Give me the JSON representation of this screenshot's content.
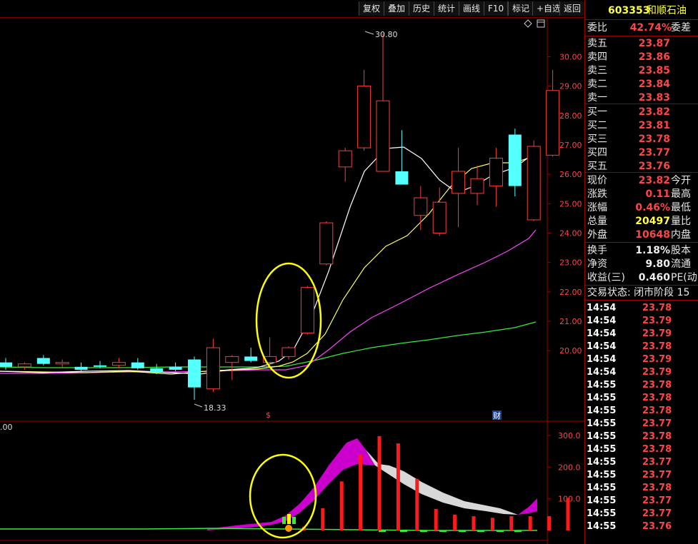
{
  "toolbar": {
    "buttons": [
      "复权",
      "叠加",
      "历史",
      "统计",
      "画线",
      "F10",
      "标记",
      "+自选",
      "返回"
    ]
  },
  "stock": {
    "code": "603353",
    "name": "和顺石油"
  },
  "main_chart": {
    "price_ticks": [
      "30.00",
      "29.00",
      "28.00",
      "27.00",
      "26.00",
      "25.00",
      "24.00",
      "23.00",
      "22.00",
      "21.00",
      "20.00"
    ],
    "high_label": "30.80",
    "low_label": "18.33",
    "markers": {
      "s_mark": "$",
      "cai_mark": "财"
    },
    "colors": {
      "up": "#ff3b3b",
      "down": "#54ffff",
      "ma5": "#ffffff",
      "ma10": "#ffff66",
      "ma20": "#ff44ff",
      "ma60": "#33ee33",
      "highlight": "#ffff00"
    }
  },
  "sub_chart": {
    "left_label": ".00",
    "ticks": [
      "300.0",
      "200.0",
      "100.0"
    ]
  },
  "chart_data": [
    {
      "type": "candlestick",
      "y_range": [
        17.6,
        31.2
      ],
      "candles": [
        {
          "o": 19.6,
          "h": 19.75,
          "l": 19.35,
          "c": 19.45
        },
        {
          "o": 19.45,
          "h": 19.6,
          "l": 19.35,
          "c": 19.55
        },
        {
          "o": 19.75,
          "h": 19.85,
          "l": 19.5,
          "c": 19.55
        },
        {
          "o": 19.55,
          "h": 19.7,
          "l": 19.4,
          "c": 19.6
        },
        {
          "o": 19.45,
          "h": 19.6,
          "l": 19.3,
          "c": 19.35
        },
        {
          "o": 19.5,
          "h": 19.65,
          "l": 19.4,
          "c": 19.45
        },
        {
          "o": 19.5,
          "h": 19.75,
          "l": 19.4,
          "c": 19.6
        },
        {
          "o": 19.6,
          "h": 19.75,
          "l": 19.35,
          "c": 19.4
        },
        {
          "o": 19.4,
          "h": 19.55,
          "l": 19.2,
          "c": 19.25
        },
        {
          "o": 19.45,
          "h": 19.6,
          "l": 19.3,
          "c": 19.35
        },
        {
          "o": 19.7,
          "h": 19.8,
          "l": 18.33,
          "c": 18.75
        },
        {
          "o": 18.7,
          "h": 20.4,
          "l": 18.6,
          "c": 20.1
        },
        {
          "o": 19.6,
          "h": 19.85,
          "l": 19.0,
          "c": 19.8
        },
        {
          "o": 19.8,
          "h": 20.1,
          "l": 19.6,
          "c": 19.65
        },
        {
          "o": 19.6,
          "h": 20.45,
          "l": 19.5,
          "c": 19.8
        },
        {
          "o": 19.8,
          "h": 20.15,
          "l": 19.7,
          "c": 20.1
        },
        {
          "o": 20.6,
          "h": 22.2,
          "l": 20.55,
          "c": 22.15
        },
        {
          "o": 22.95,
          "h": 24.4,
          "l": 22.9,
          "c": 24.35
        },
        {
          "o": 26.25,
          "h": 26.9,
          "l": 25.75,
          "c": 26.8
        },
        {
          "o": 26.9,
          "h": 29.55,
          "l": 26.8,
          "c": 29.0
        },
        {
          "o": 26.1,
          "h": 30.8,
          "l": 26.1,
          "c": 28.5
        },
        {
          "o": 26.1,
          "h": 27.5,
          "l": 25.7,
          "c": 25.65
        },
        {
          "o": 24.6,
          "h": 25.6,
          "l": 24.1,
          "c": 25.2
        },
        {
          "o": 24.0,
          "h": 25.55,
          "l": 23.9,
          "c": 25.05
        },
        {
          "o": 25.35,
          "h": 26.9,
          "l": 24.2,
          "c": 26.1
        },
        {
          "o": 25.35,
          "h": 26.3,
          "l": 24.95,
          "c": 25.85
        },
        {
          "o": 25.6,
          "h": 26.9,
          "l": 24.9,
          "c": 26.55
        },
        {
          "o": 27.35,
          "h": 27.55,
          "l": 25.25,
          "c": 25.6
        },
        {
          "o": 24.45,
          "h": 27.15,
          "l": 24.4,
          "c": 26.95
        },
        {
          "o": 26.65,
          "h": 29.55,
          "l": 26.6,
          "c": 28.85
        }
      ]
    },
    {
      "type": "bar",
      "y_range": [
        0,
        300
      ],
      "values": [
        0,
        0,
        0,
        0,
        0,
        0,
        0,
        0,
        0,
        0,
        0,
        0,
        0,
        0,
        0,
        0,
        12,
        70,
        155,
        240,
        298,
        275,
        163,
        68,
        50,
        45,
        40,
        45,
        45,
        45,
        102
      ]
    }
  ],
  "side_panel": {
    "weibi": {
      "label": "委比",
      "value": "42.74%",
      "label2": "委差"
    },
    "sells": [
      {
        "label": "卖五",
        "price": "23.87"
      },
      {
        "label": "卖四",
        "price": "23.86"
      },
      {
        "label": "卖三",
        "price": "23.85"
      },
      {
        "label": "卖二",
        "price": "23.84"
      },
      {
        "label": "卖一",
        "price": "23.83"
      }
    ],
    "buys": [
      {
        "label": "买一",
        "price": "23.82"
      },
      {
        "label": "买二",
        "price": "23.81"
      },
      {
        "label": "买三",
        "price": "23.78"
      },
      {
        "label": "买四",
        "price": "23.77"
      },
      {
        "label": "买五",
        "price": "23.76"
      }
    ],
    "stats1": [
      {
        "label": "现价",
        "value": "23.82",
        "label2": "今开"
      },
      {
        "label": "涨跌",
        "value": "0.11",
        "label2": "最高"
      },
      {
        "label": "涨幅",
        "value": "0.46%",
        "label2": "最低"
      },
      {
        "label": "总量",
        "value": "20497",
        "label2": "量比"
      },
      {
        "label": "外盘",
        "value": "10648",
        "label2": "内盘"
      }
    ],
    "stats2": [
      {
        "label": "换手",
        "value": "1.18%",
        "label2": "股本"
      },
      {
        "label": "净资",
        "value": "9.80",
        "label2": "流通"
      },
      {
        "label": "收益(三)",
        "value": "0.460",
        "label2": "PE(动"
      }
    ],
    "trade_status": "交易状态: 闭市阶段 15",
    "ticks": [
      {
        "time": "14:54",
        "price": "23.78"
      },
      {
        "time": "14:54",
        "price": "23.79"
      },
      {
        "time": "14:54",
        "price": "23.79"
      },
      {
        "time": "14:54",
        "price": "23.78"
      },
      {
        "time": "14:54",
        "price": "23.79"
      },
      {
        "time": "14:54",
        "price": "23.79"
      },
      {
        "time": "14:55",
        "price": "23.78"
      },
      {
        "time": "14:55",
        "price": "23.78"
      },
      {
        "time": "14:55",
        "price": "23.78"
      },
      {
        "time": "14:55",
        "price": "23.77"
      },
      {
        "time": "14:55",
        "price": "23.78"
      },
      {
        "time": "14:55",
        "price": "23.78"
      },
      {
        "time": "14:55",
        "price": "23.77"
      },
      {
        "time": "14:55",
        "price": "23.77"
      },
      {
        "time": "14:55",
        "price": "23.78"
      },
      {
        "time": "14:55",
        "price": "23.77"
      },
      {
        "time": "14:55",
        "price": "23.77"
      },
      {
        "time": "14:55",
        "price": "23.76"
      }
    ]
  }
}
